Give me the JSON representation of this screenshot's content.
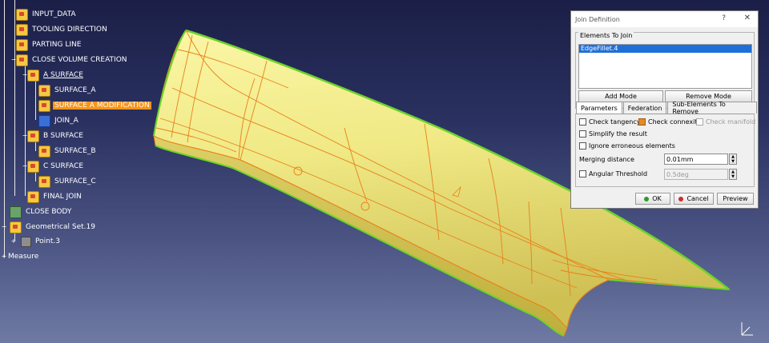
{
  "tree": {
    "items": [
      {
        "label": "INPUT_DATA"
      },
      {
        "label": "TOOLING DIRECTION"
      },
      {
        "label": "PARTING LINE"
      },
      {
        "label": "CLOSE VOLUME CREATION"
      },
      {
        "label": "A SURFACE"
      },
      {
        "label": "SURFACE_A"
      },
      {
        "label": "SURFACE A MODIFICATION"
      },
      {
        "label": "JOIN_A"
      },
      {
        "label": "B SURFACE"
      },
      {
        "label": "SURFACE_B"
      },
      {
        "label": "C SURFACE"
      },
      {
        "label": "SURFACE_C"
      },
      {
        "label": "FINAL JOIN"
      },
      {
        "label": "CLOSE BODY"
      },
      {
        "label": "Geometrical Set.19"
      },
      {
        "label": "Point.3"
      },
      {
        "label": "Measure"
      }
    ],
    "selected_color": "#f7941d"
  },
  "dialog": {
    "title": "Join Definition",
    "help": "?",
    "close": "✕",
    "elements_group": "Elements To Join",
    "elements": [
      "EdgeFillet.4"
    ],
    "add_mode": "Add Mode",
    "remove_mode": "Remove Mode",
    "tabs": [
      "Parameters",
      "Federation",
      "Sub-Elements To Remove"
    ],
    "check_tangency": "Check tangency",
    "check_connexity": "Check connexity",
    "check_manifold": "Check manifold",
    "simplify": "Simplify the result",
    "ignore": "Ignore erroneous elements",
    "merging_label": "Merging distance",
    "merging_value": "0.01mm",
    "angular_label": "Angular Threshold",
    "angular_value": "0.5deg",
    "ok": "OK",
    "cancel": "Cancel",
    "preview": "Preview"
  },
  "colors": {
    "surface": "#f2ee8a",
    "edge_orange": "#e8801a",
    "boundary_green": "#6ad32a",
    "selection_blue": "#1f6fd8"
  }
}
